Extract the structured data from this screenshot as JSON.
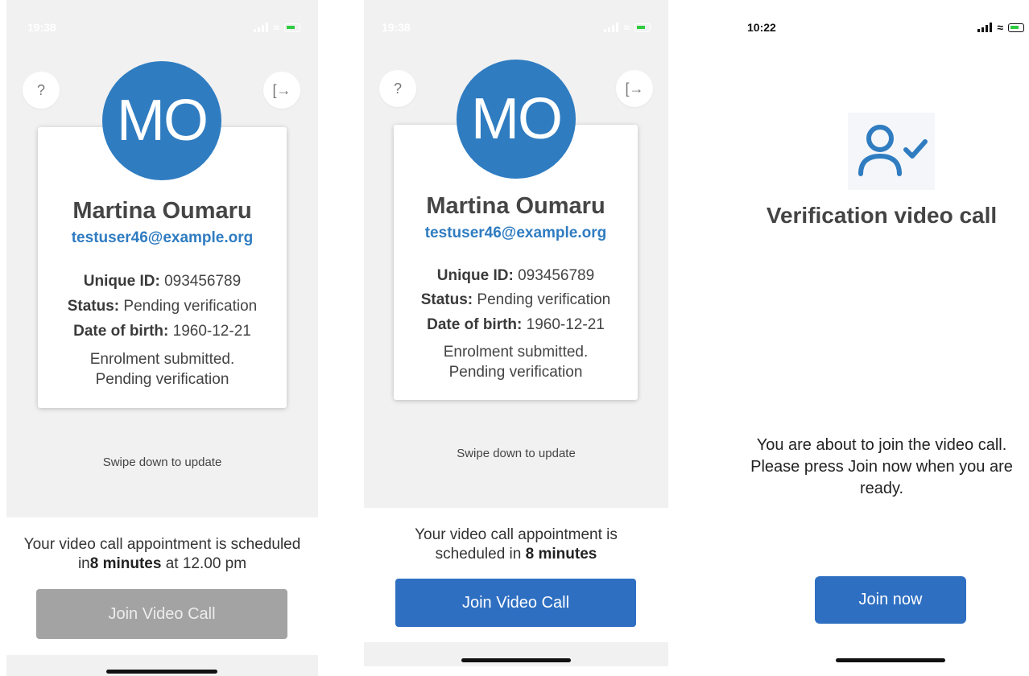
{
  "screens": [
    {
      "status_time": "19:38",
      "help_label": "?",
      "logout_label": "[→",
      "avatar_initials": "MO",
      "name": "Martina Oumaru",
      "email": "testuser46@example.org",
      "unique_id_label": "Unique ID:",
      "unique_id": "093456789",
      "status_label": "Status:",
      "status_value": "Pending verification",
      "dob_label": "Date of birth:",
      "dob": "1960-12-21",
      "note_line1": "Enrolment submitted.",
      "note_line2": "Pending verification",
      "swipe_hint": "Swipe down to update",
      "appointment_prefix": "Your video call appointment is scheduled in",
      "appointment_time": "8 minutes",
      "appointment_suffix": "at 12.00 pm",
      "join_label": "Join Video Call",
      "join_enabled": false
    },
    {
      "status_time": "19:38",
      "help_label": "?",
      "logout_label": "[→",
      "avatar_initials": "MO",
      "name": "Martina Oumaru",
      "email": "testuser46@example.org",
      "unique_id_label": "Unique ID:",
      "unique_id": "093456789",
      "status_label": "Status:",
      "status_value": "Pending verification",
      "dob_label": "Date of birth:",
      "dob": "1960-12-21",
      "note_line1": "Enrolment submitted.",
      "note_line2": "Pending verification",
      "swipe_hint": "Swipe down to update",
      "appointment_prefix": "Your video call appointment is scheduled in",
      "appointment_time": "8 minutes",
      "join_label": "Join Video Call",
      "join_enabled": true
    },
    {
      "status_time": "10:22",
      "icon": "user-check-icon",
      "title": "Verification video call",
      "message_line1": "You are about to join the video call.",
      "message_line2": "Please press Join now when you are",
      "message_line3": "ready.",
      "join_label": "Join now"
    }
  ],
  "colors": {
    "primary": "#2f7cc1",
    "button_blue": "#2e6fc2",
    "button_disabled": "#a3a3a3",
    "background_gray": "#f1f1f1"
  }
}
